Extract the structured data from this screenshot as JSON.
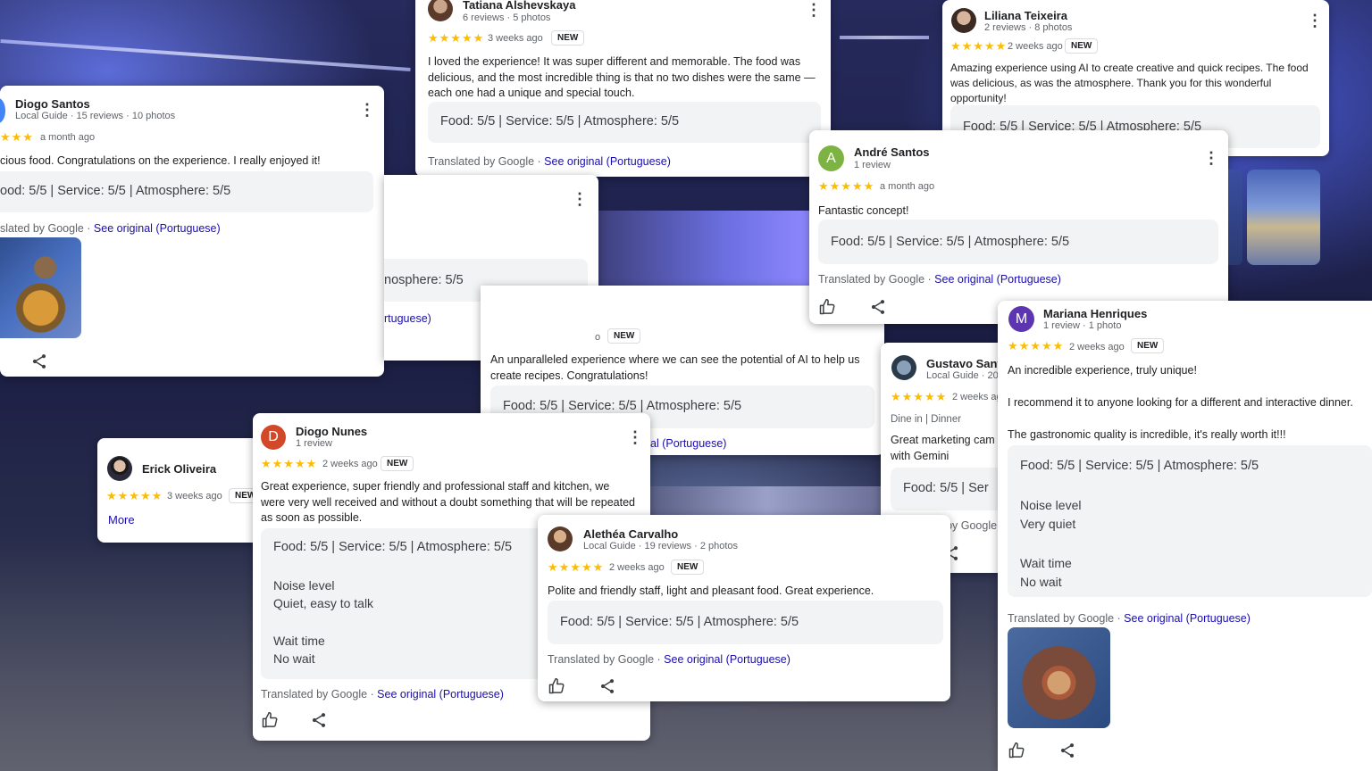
{
  "reviews": {
    "tatiana": {
      "name": "Tatiana Alshevskaya",
      "meta": "6 reviews · 5 photos",
      "stars": "★★★★★",
      "when": "3 weeks ago",
      "badge": "NEW",
      "text": "I loved the experience! It was super different and memorable. The food was delicious, and the most incredible thing is that no two dishes were the same — each one had a unique and special touch.",
      "ratings": "Food: 5/5  |  Service: 5/5  |  Atmosphere: 5/5",
      "translated": "Translated by Google · ",
      "see_original": "See original (Portuguese)"
    },
    "liliana": {
      "name": "Liliana Teixeira",
      "meta": "2 reviews · 8 photos",
      "stars": "★★★★★",
      "when": "2 weeks ago",
      "badge": "NEW",
      "text": "Amazing experience using AI to create creative and quick recipes. The food was delicious, as was the atmosphere. Thank you for this wonderful opportunity!",
      "ratings": "Food: 5/5  |  Service: 5/5  |  Atmosphere: 5/5"
    },
    "diogo_santos": {
      "name": "Diogo Santos",
      "meta": "Local Guide · 15 reviews · 10 photos",
      "stars": "★★★",
      "when": "a month ago",
      "text": "cious food. Congratulations on the experience. I really enjoyed it!",
      "ratings": "ood: 5/5  |  Service: 5/5  |  Atmosphere: 5/5",
      "translated": "slated by Google · ",
      "see_original": "See original (Portuguese)"
    },
    "hidden_card": {
      "ratings": "nosphere: 5/5",
      "see_original": "rtuguese)"
    },
    "andre": {
      "avatar_letter": "A",
      "name": "André Santos",
      "meta": "1 review",
      "stars": "★★★★★",
      "when": "a month ago",
      "text": "Fantastic concept!",
      "ratings": "Food: 5/5  |  Service: 5/5  |  Atmosphere: 5/5",
      "translated": "Translated by Google · ",
      "see_original": "See original (Portuguese)"
    },
    "middle": {
      "when_tail": "o",
      "badge": "NEW",
      "text": "An unparalleled experience where we can see the potential of AI to help us create recipes. Congratulations!",
      "ratings": "Food: 5/5  |  Service: 5/5  |  Atmosphere: 5/5",
      "see_original": "al (Portuguese)"
    },
    "mariana": {
      "avatar_letter": "M",
      "name": "Mariana Henriques",
      "meta": "1 review · 1 photo",
      "stars": "★★★★★",
      "when": "2 weeks ago",
      "badge": "NEW",
      "text1": "An incredible experience, truly unique!",
      "text2": "I recommend it to anyone looking for a different and interactive dinner.",
      "text3": "The gastronomic quality is incredible, it's really worth it!!!",
      "ratings": "Food: 5/5  |  Service: 5/5  |  Atmosphere: 5/5",
      "noise_label": "Noise level",
      "noise_value": "Very quiet",
      "wait_label": "Wait time",
      "wait_value": "No wait",
      "translated": "Translated by Google · ",
      "see_original": "See original (Portuguese)"
    },
    "gustavo": {
      "name": "Gustavo Sant",
      "meta": "Local Guide · 20",
      "stars": "★★★★★",
      "when": "2 weeks ag",
      "tags": "Dine in  |  Dinner",
      "text": "Great marketing cam with Gemini",
      "ratings": "Food: 5/5  |  Ser",
      "translated": "Translated by Google"
    },
    "erick": {
      "name": "Erick Oliveira",
      "stars": "★★★★★",
      "when": "3 weeks ago",
      "badge": "NEW",
      "more": "More"
    },
    "diogo_nunes": {
      "avatar_letter": "D",
      "name": "Diogo Nunes",
      "meta": "1 review",
      "stars": "★★★★★",
      "when": "2 weeks ago",
      "badge": "NEW",
      "text": "Great experience, super friendly and professional staff and kitchen, we were very well received and without a doubt something that will be repeated as soon as possible.",
      "ratings": "Food: 5/5  |  Service: 5/5  |  Atmosphere: 5/5",
      "noise_label": "Noise level",
      "noise_value": "Quiet, easy to talk",
      "wait_label": "Wait time",
      "wait_value": "No wait",
      "translated": "Translated by Google · ",
      "see_original": "See original (Portuguese)"
    },
    "alethea": {
      "name": "Alethéa Carvalho",
      "meta": "Local Guide · 19 reviews · 2 photos",
      "stars": "★★★★★",
      "when": "2 weeks ago",
      "badge": "NEW",
      "text": "Polite and friendly staff, light and pleasant food. Great experience.",
      "ratings": "Food: 5/5  |  Service: 5/5  |  Atmosphere: 5/5",
      "translated": "Translated by Google · ",
      "see_original": "See original (Portuguese)"
    }
  },
  "icons": {
    "like": "thumbs-up-icon",
    "share": "share-icon",
    "more": "more-vertical-icon"
  },
  "colors": {
    "star": "#fbbc04",
    "link": "#1a0dab",
    "avatar_andre": "#7cb342",
    "avatar_mariana": "#5e35b1",
    "avatar_diogo_nunes": "#d2492a"
  }
}
